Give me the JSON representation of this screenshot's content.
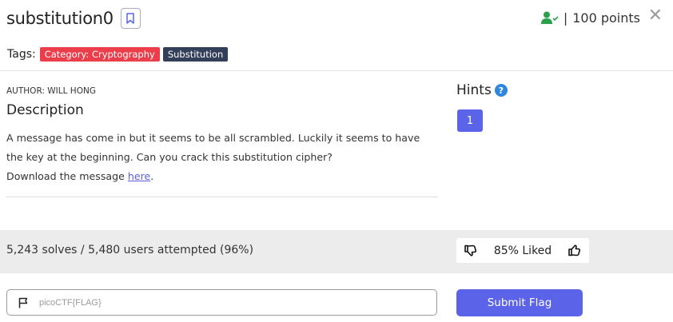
{
  "challenge": {
    "title": "substitution0",
    "points": "100 points",
    "separator": "|",
    "close_symbol": "✕"
  },
  "tags": {
    "label": "Tags:",
    "items": [
      {
        "text": "Category: Cryptography",
        "color": "#ec3d4a"
      },
      {
        "text": "Substitution",
        "color": "#333e58"
      }
    ]
  },
  "description": {
    "author": "AUTHOR: WILL HONG",
    "heading": "Description",
    "line1": "A message has come in but it seems to be all scrambled. Luckily it seems to have the key at the beginning. Can you crack this substitution cipher?",
    "download_prefix": "Download the message ",
    "download_link": "here",
    "download_suffix": "."
  },
  "hints": {
    "heading": "Hints",
    "help_symbol": "?",
    "buttons": [
      "1"
    ]
  },
  "stats": {
    "solves_text": "5,243 solves / 5,480 users attempted (96%)",
    "liked_text": "85% Liked"
  },
  "flag_form": {
    "placeholder": "picoCTF{FLAG}",
    "submit_label": "Submit Flag"
  },
  "colors": {
    "accent": "#5b63e8",
    "solved_icon": "#2aa04a",
    "help_icon": "#2f86e0"
  },
  "icons": {
    "bookmark": "bookmark-icon",
    "user_check": "user-check-icon",
    "close": "close-icon",
    "help": "help-icon",
    "thumbs_down": "thumbs-down-icon",
    "thumbs_up": "thumbs-up-icon",
    "flag": "flag-icon"
  }
}
